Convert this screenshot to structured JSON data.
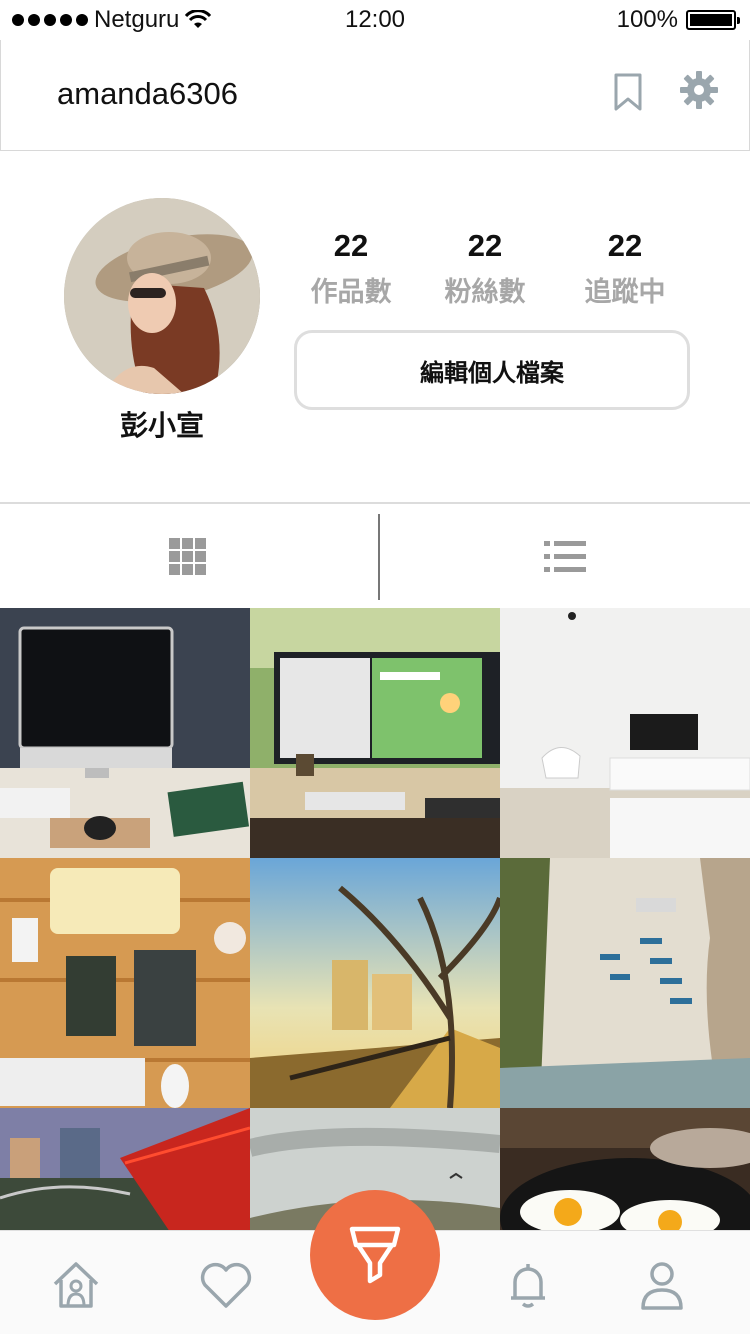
{
  "status_bar": {
    "carrier": "Netguru",
    "time": "12:00",
    "battery": "100%",
    "battery_level": 1.0
  },
  "header": {
    "username": "amanda6306",
    "icons": [
      "bookmark-icon",
      "gear-icon"
    ]
  },
  "profile": {
    "display_name": "彭小宣",
    "stats": [
      {
        "value": "22",
        "label": "作品數"
      },
      {
        "value": "22",
        "label": "粉絲數"
      },
      {
        "value": "22",
        "label": "追蹤中"
      }
    ],
    "edit_button_label": "編輯個人檔案"
  },
  "tabs": [
    {
      "icon": "grid-icon",
      "active": true
    },
    {
      "icon": "list-icon",
      "active": false
    }
  ],
  "photos": [
    {
      "subject": "desk-imac"
    },
    {
      "subject": "desk-monitor"
    },
    {
      "subject": "white-living-room"
    },
    {
      "subject": "wooden-desk-items"
    },
    {
      "subject": "autumn-tree-path"
    },
    {
      "subject": "beach-boats"
    },
    {
      "subject": "red-bridge"
    },
    {
      "subject": "cloudy-sky-bird"
    },
    {
      "subject": "fried-eggs-pan"
    }
  ],
  "bottom_nav": {
    "items": [
      "home-icon",
      "heart-icon",
      "filter-icon",
      "bell-icon",
      "user-icon"
    ],
    "accent_color": "#ee6f45",
    "icon_color": "#9aa6ad"
  }
}
